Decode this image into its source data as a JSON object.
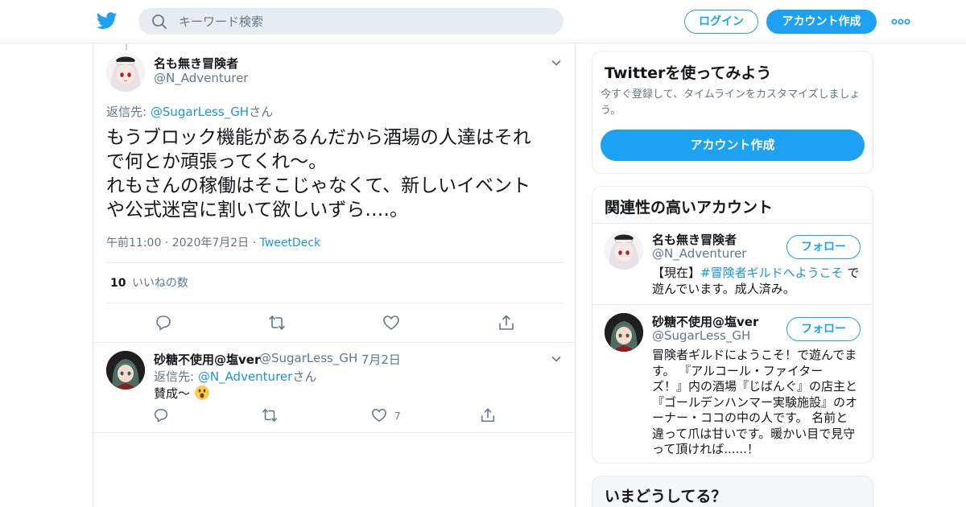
{
  "header": {
    "search_placeholder": "キーワード検索",
    "login_label": "ログイン",
    "signup_label": "アカウント作成"
  },
  "main_tweet": {
    "author_name": "名も無き冒険者",
    "author_handle": "@N_Adventurer",
    "reply_prefix": "返信先: ",
    "reply_mention": "@SugarLess_GH",
    "reply_suffix": "さん",
    "text_line1": "もうブロック機能があるんだから酒場の人達はそれ",
    "text_line2": "で何とか頑張ってくれ～。",
    "text_line3": "れもさんの稼働はそこじゃなくて、新しいイベント",
    "text_line4": "や公式迷宮に割いて欲しいずら‥‥。",
    "time": "午前11:00",
    "date": "2020年7月2日",
    "source": "TweetDeck",
    "like_count": "10",
    "like_label": "いいねの数"
  },
  "reply_tweet": {
    "author_name": "砂糖不使用@塩ver",
    "author_handle": "@SugarLess_GH",
    "date": "7月2日",
    "reply_prefix": "返信先: ",
    "reply_mention": "@N_Adventurer",
    "reply_suffix": "さん",
    "text": "賛成～",
    "like_count": "7"
  },
  "sidebar": {
    "signup_card": {
      "title": "Twitterを使ってみよう",
      "subtitle_line1": "今すぐ登録して、タイムラインをカスタマイズしましょ",
      "subtitle_line2": "う。",
      "button_label": "アカウント作成"
    },
    "related_card": {
      "title": "関連性の高いアカウント",
      "accounts": [
        {
          "name": "名も無き冒険者",
          "handle": "@N_Adventurer",
          "follow_label": "フォロー",
          "bio_prefix": "【現在】",
          "bio_tag": "#冒険者ギルドへようこそ",
          "bio_suffix": " で",
          "bio_line2": "遊んでいます。成人済み。"
        },
        {
          "name": "砂糖不使用@塩ver",
          "handle": "@SugarLess_GH",
          "follow_label": "フォロー",
          "bio_lines": [
            "冒険者ギルドにようこそ！で遊んでま",
            "す。 『アルコール・ファイター",
            "ズ！』内の酒場『じばんぐ』の店主と",
            "『ゴールデンハンマー実験施設』のオ",
            "ーナー・ココの中の人です。 名前と",
            "違って爪は甘いです。暖かい目で見守",
            "って頂ければ......！"
          ]
        }
      ]
    },
    "trends_card": {
      "title": "いまどうしてる？"
    }
  },
  "colors": {
    "accent": "#1da1f2",
    "link": "#1b95e0",
    "secondary_text": "#657786",
    "border": "#e6ecf0"
  }
}
